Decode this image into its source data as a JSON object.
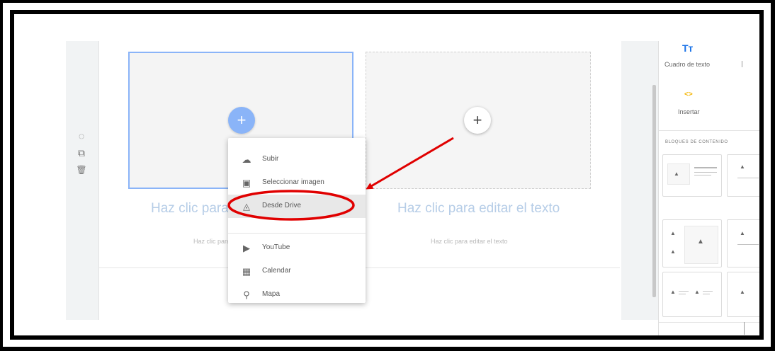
{
  "section_tools": [
    {
      "icon": "palette-icon",
      "glyph": "◌"
    },
    {
      "icon": "duplicate-icon",
      "glyph": "⧉"
    },
    {
      "icon": "delete-icon",
      "glyph": "🗑"
    }
  ],
  "placeholders": [
    {
      "heading": "Haz clic para editar el texto",
      "body": "Haz clic para editar el texto"
    },
    {
      "heading": "Haz clic para editar el texto",
      "body": "Haz clic para editar el texto"
    }
  ],
  "add_button_glyph": "+",
  "menu": {
    "items": [
      {
        "label": "Subir",
        "icon": "cloud-upload-icon",
        "glyph": "☁"
      },
      {
        "label": "Seleccionar imagen",
        "icon": "image-icon",
        "glyph": "▣"
      },
      {
        "label": "Desde Drive",
        "icon": "drive-icon",
        "glyph": "◬"
      },
      {
        "label": "YouTube",
        "icon": "youtube-icon",
        "glyph": "▶"
      },
      {
        "label": "Calendar",
        "icon": "calendar-icon",
        "glyph": "▦"
      },
      {
        "label": "Mapa",
        "icon": "map-pin-icon",
        "glyph": "⚲"
      }
    ],
    "highlighted_index": 2
  },
  "panel": {
    "text_box": {
      "icon_text": "Tт",
      "label": "Cuadro de texto"
    },
    "embed": {
      "icon_text": "<>",
      "label": "Insertar"
    },
    "content_blocks_heading": "BLOQUES DE CONTENIDO"
  },
  "colors": {
    "accent_blue": "#8ab4f8",
    "highlight_red": "#e00000",
    "embed_orange": "#f4b400",
    "text_box_blue": "#1a73e8"
  }
}
